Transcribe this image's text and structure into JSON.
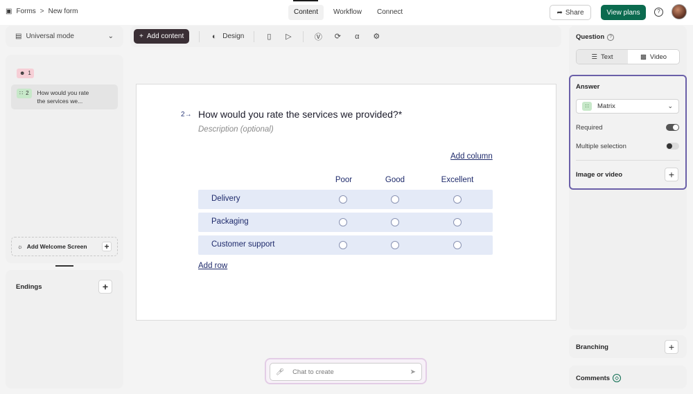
{
  "header": {
    "breadcrumb_root": "Forms",
    "breadcrumb_current": "New form",
    "tabs": [
      {
        "label": "Content"
      },
      {
        "label": "Workflow"
      },
      {
        "label": "Connect"
      }
    ],
    "share_label": "Share",
    "view_plans_label": "View plans",
    "help_glyph": "?"
  },
  "left": {
    "mode_label": "Universal mode",
    "questions": [
      {
        "number": "1",
        "title": "",
        "icon": "contact-icon"
      },
      {
        "number": "2",
        "title": "How would you rate the services we...",
        "icon": "matrix-icon"
      }
    ],
    "welcome_label": "Add Welcome Screen",
    "endings_label": "Endings"
  },
  "toolbar": {
    "add_content_label": "Add content",
    "design_label": "Design"
  },
  "question": {
    "number": "2",
    "title": "How would you rate the services we provided?*",
    "description_placeholder": "Description (optional)",
    "add_column_label": "Add column",
    "add_row_label": "Add row",
    "columns": [
      "Poor",
      "Good",
      "Excellent"
    ],
    "rows": [
      "Delivery",
      "Packaging",
      "Customer support"
    ]
  },
  "chat": {
    "placeholder": "Chat to create"
  },
  "right": {
    "question_label": "Question",
    "type_options": [
      {
        "label": "Text",
        "selected": true
      },
      {
        "label": "Video",
        "selected": false
      }
    ],
    "answer_label": "Answer",
    "answer_type": "Matrix",
    "required_label": "Required",
    "required_on": true,
    "multiple_label": "Multiple selection",
    "multiple_on": false,
    "image_label": "Image or video",
    "branching_label": "Branching",
    "comments_label": "Comments"
  },
  "colors": {
    "accent_green": "#0b6b4f",
    "answer_border": "#6a5fa8",
    "matrix_row_bg": "#e4eaf7",
    "text_navy": "#1e2a6b"
  }
}
